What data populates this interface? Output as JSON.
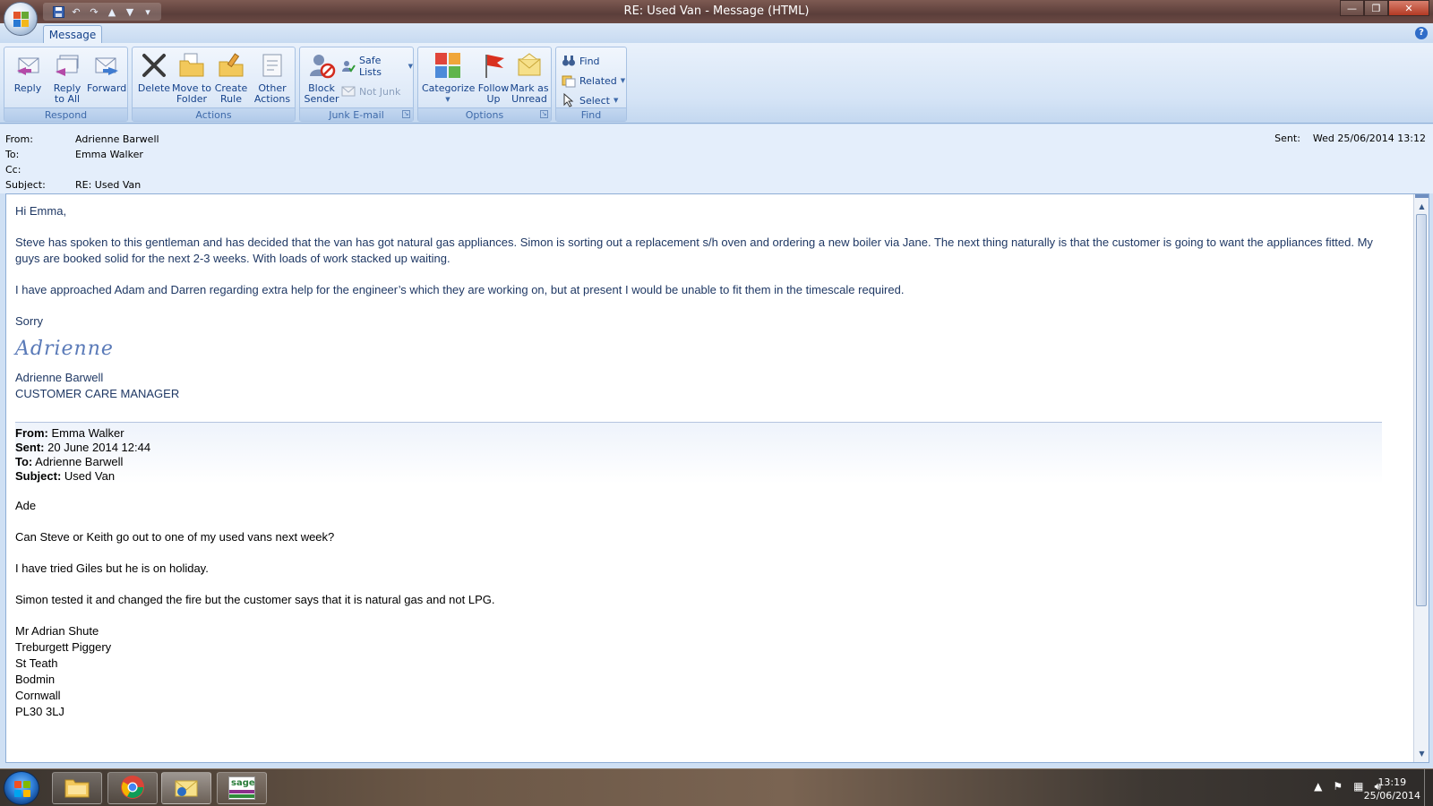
{
  "window": {
    "title": "RE: Used Van  - Message (HTML)"
  },
  "tabs": [
    {
      "label": "Message"
    }
  ],
  "ribbon": {
    "respond": {
      "label": "Respond",
      "reply": "Reply",
      "reply_all": "Reply\nto All",
      "forward": "Forward"
    },
    "actions": {
      "label": "Actions",
      "delete": "Delete",
      "move_to_folder": "Move to\nFolder",
      "create_rule": "Create\nRule",
      "other_actions": "Other\nActions"
    },
    "junk": {
      "label": "Junk E-mail",
      "block_sender": "Block\nSender",
      "safe_lists": "Safe Lists",
      "not_junk": "Not Junk"
    },
    "options": {
      "label": "Options",
      "categorize": "Categorize",
      "follow_up": "Follow\nUp",
      "mark_as_unread": "Mark as\nUnread"
    },
    "find": {
      "label": "Find",
      "find": "Find",
      "related": "Related",
      "select": "Select"
    }
  },
  "header": {
    "from_label": "From:",
    "from": "Adrienne Barwell",
    "to_label": "To:",
    "to": "Emma Walker",
    "cc_label": "Cc:",
    "cc": "",
    "subject_label": "Subject:",
    "subject": "RE: Used Van",
    "sent_label": "Sent:",
    "sent": "Wed 25/06/2014 13:12"
  },
  "body": {
    "greeting": "Hi Emma,",
    "para1": "Steve has spoken to this gentleman and has decided that the van has got natural gas appliances.  Simon is sorting out a replacement s/h oven and ordering a new boiler via Jane.  The next thing naturally is that the customer  is going to want the appliances fitted.  My guys are booked solid for the next 2-3 weeks. With loads of work stacked up waiting.",
    "para2": "I have approached Adam and Darren regarding extra help for the engineer’s which they are working on, but at present I would be unable to fit them  in the timescale required.",
    "closing": "Sorry",
    "signature": "Adrienne",
    "sig_name": "Adrienne Barwell",
    "sig_title": "CUSTOMER CARE MANAGER"
  },
  "quoted": {
    "from_label": "From:",
    "from": "Emma Walker",
    "sent_label": "Sent:",
    "sent": "20 June 2014 12:44",
    "to_label": "To:",
    "to": "Adrienne Barwell",
    "subject_label": "Subject:",
    "subject": "Used Van",
    "greeting": "Ade",
    "line1": "Can Steve or Keith go out to one of my used vans next week?",
    "line2": "I have tried Giles but he is on holiday.",
    "line3": "Simon tested it and changed the fire but the customer says that it is natural gas and not LPG.",
    "address": [
      "Mr Adrian Shute",
      "Treburgett Piggery",
      "St Teath",
      "Bodmin",
      "Cornwall",
      "PL30 3LJ"
    ]
  },
  "taskbar": {
    "time": "13:19",
    "date": "25/06/2014",
    "sage_label": "sage"
  }
}
